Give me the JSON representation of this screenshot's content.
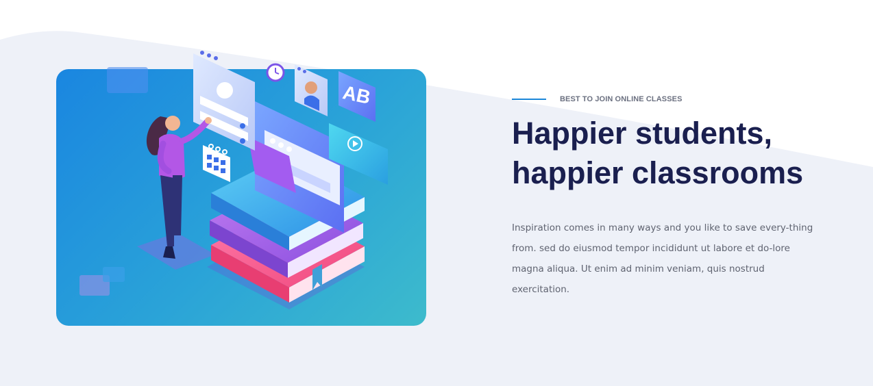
{
  "section": {
    "eyebrow": "BEST TO JOIN ONLINE CLASSES",
    "headline_line1": "Happier students,",
    "headline_line2": "happier classrooms",
    "description": "Inspiration comes in many ways and you like to save every-thing from. sed do eiusmod tempor incididunt ut labore et do-lore magna aliqua. Ut enim ad minim veniam, quis nostrud exercitation.",
    "illustration": {
      "badge_text": "AB"
    }
  },
  "colors": {
    "background_wave": "#eef1f8",
    "accent": "#1a86d8",
    "heading": "#1a1f4f",
    "body_text": "#5f6370"
  }
}
